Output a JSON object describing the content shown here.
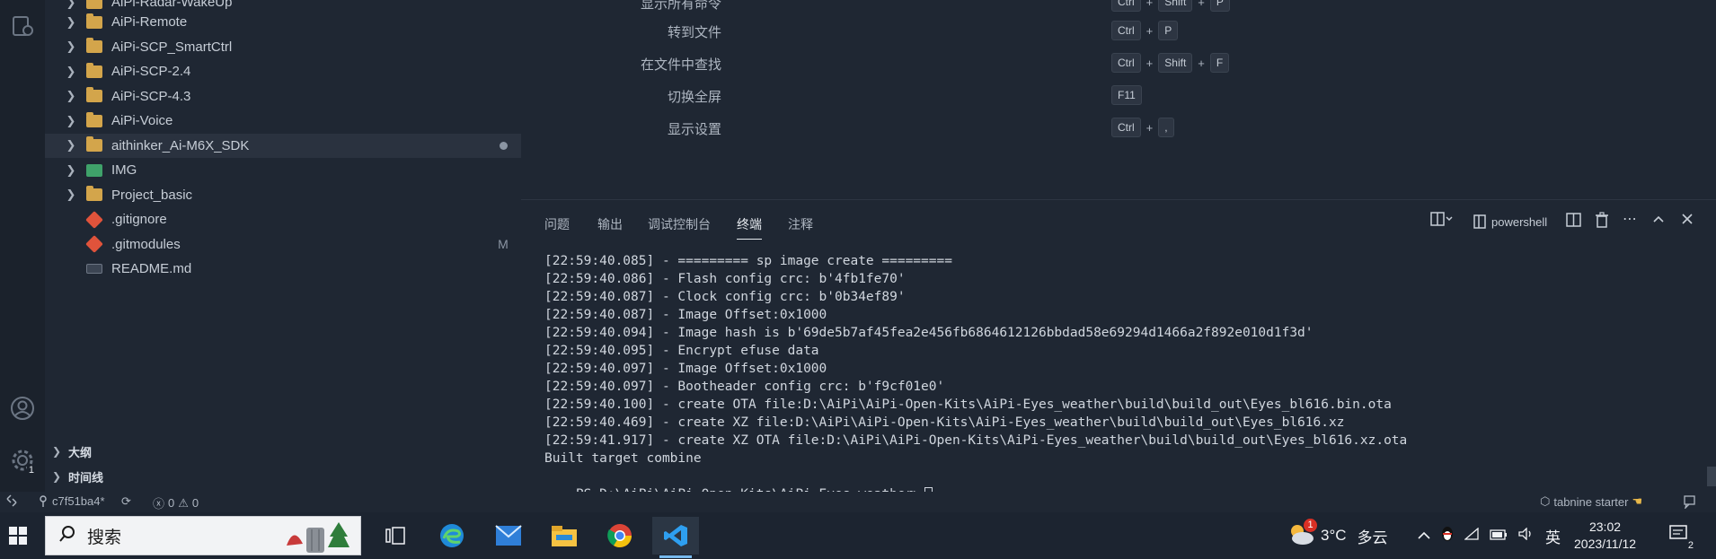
{
  "explorer": {
    "partial_top_item": "AiPi-Radar-WakeUp",
    "items": [
      {
        "label": "AiPi-Remote",
        "type": "folder",
        "decor": ""
      },
      {
        "label": "AiPi-SCP_SmartCtrl",
        "type": "folder",
        "decor": ""
      },
      {
        "label": "AiPi-SCP-2.4",
        "type": "folder",
        "decor": ""
      },
      {
        "label": "AiPi-SCP-4.3",
        "type": "folder",
        "decor": ""
      },
      {
        "label": "AiPi-Voice",
        "type": "folder",
        "decor": ""
      },
      {
        "label": "aithinker_Ai-M6X_SDK",
        "type": "folder",
        "decor": "dot"
      },
      {
        "label": "IMG",
        "type": "image-folder",
        "decor": ""
      },
      {
        "label": "Project_basic",
        "type": "folder",
        "decor": ""
      },
      {
        "label": ".gitignore",
        "type": "git",
        "decor": ""
      },
      {
        "label": ".gitmodules",
        "type": "git",
        "decor": "M"
      },
      {
        "label": "README.md",
        "type": "markdown",
        "decor": ""
      }
    ]
  },
  "sections": {
    "outline": "大纲",
    "timeline": "时间线"
  },
  "activity": {
    "settings_badge": "1"
  },
  "shortcuts": {
    "partial_top": {
      "label": "显示所有命令",
      "keys": [
        "Ctrl",
        "Shift",
        "P"
      ]
    },
    "rows": [
      {
        "label": "转到文件",
        "keys": [
          "Ctrl",
          "P"
        ]
      },
      {
        "label": "在文件中查找",
        "keys": [
          "Ctrl",
          "Shift",
          "F"
        ]
      },
      {
        "label": "切换全屏",
        "keys": [
          "F11"
        ]
      },
      {
        "label": "显示设置",
        "keys": [
          "Ctrl",
          ","
        ]
      }
    ],
    "plus": "+"
  },
  "panel": {
    "tabs": [
      "问题",
      "输出",
      "调试控制台",
      "终端",
      "注释"
    ],
    "active_tab": "终端",
    "terminal_name": "powershell"
  },
  "terminal": {
    "lines": [
      "[22:59:40.085] - ========= sp image create =========",
      "[22:59:40.086] - Flash config crc: b'4fb1fe70'",
      "[22:59:40.087] - Clock config crc: b'0b34ef89'",
      "[22:59:40.087] - Image Offset:0x1000",
      "[22:59:40.094] - Image hash is b'69de5b7af45fea2e456fb6864612126bbdad58e69294d1466a2f892e010d1f3d'",
      "[22:59:40.095] - Encrypt efuse data",
      "[22:59:40.097] - Image Offset:0x1000",
      "[22:59:40.097] - Bootheader config crc: b'f9cf01e0'",
      "[22:59:40.100] - create OTA file:D:\\AiPi\\AiPi-Open-Kits\\AiPi-Eyes_weather\\build\\build_out\\Eyes_bl616.bin.ota",
      "[22:59:40.469] - create XZ file:D:\\AiPi\\AiPi-Open-Kits\\AiPi-Eyes_weather\\build\\build_out\\Eyes_bl616.xz",
      "[22:59:41.917] - create XZ OTA file:D:\\AiPi\\AiPi-Open-Kits\\AiPi-Eyes_weather\\build\\build_out\\Eyes_bl616.xz.ota",
      "Built target combine"
    ],
    "prompt": "PS D:\\AiPi\\AiPi-Open-Kits\\AiPi-Eyes_weather>"
  },
  "statusbar": {
    "branch": "c7f51ba4*",
    "errors": "0",
    "warnings": "0",
    "tabnine": "tabnine starter"
  },
  "taskbar": {
    "search_placeholder": "搜索",
    "weather_temp": "3°C",
    "weather_desc": "多云",
    "weather_badge": "1",
    "ime": "英",
    "time": "23:02",
    "date": "2023/11/12",
    "notif_count": "2"
  }
}
